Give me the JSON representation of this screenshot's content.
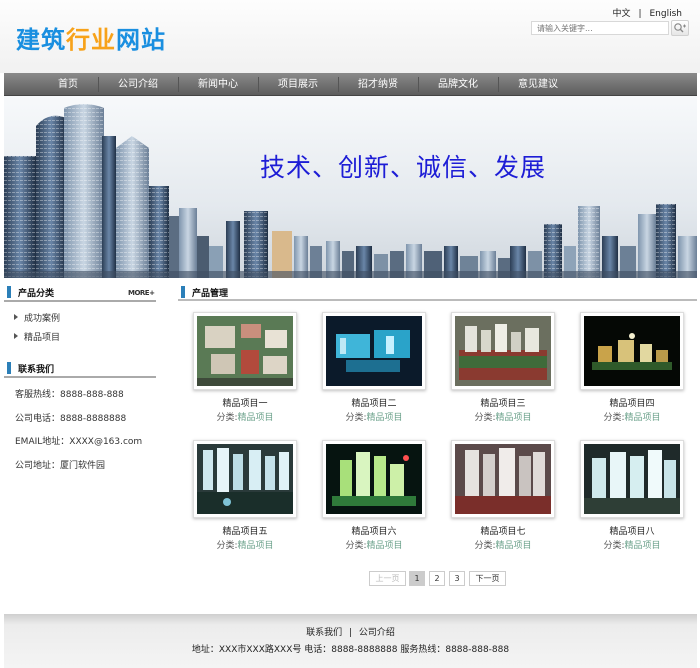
{
  "header": {
    "logo_part1": "建筑",
    "logo_part2": "行业",
    "logo_part3": "网站",
    "lang_cn": "中文",
    "lang_sep": "|",
    "lang_en": "English",
    "search_placeholder": "请输入关键字..."
  },
  "nav": {
    "items": [
      "首页",
      "公司介绍",
      "新闻中心",
      "项目展示",
      "招才纳贤",
      "品牌文化",
      "意见建议"
    ]
  },
  "banner": {
    "slogan": "技术、创新、诚信、发展"
  },
  "sidebar": {
    "category_title": "产品分类",
    "more_label": "MORE+",
    "categories": [
      "成功案例",
      "精品项目"
    ],
    "contact_title": "联系我们",
    "contacts": [
      "客服热线：8888-888-888",
      "公司电话：8888-8888888",
      "EMAIL地址：XXXX@163.com",
      "公司地址：厦门软件园"
    ]
  },
  "main": {
    "title": "产品管理",
    "category_prefix": "分类:",
    "products": [
      {
        "name": "精品项目一",
        "category": "精品项目"
      },
      {
        "name": "精品项目二",
        "category": "精品项目"
      },
      {
        "name": "精品项目三",
        "category": "精品项目"
      },
      {
        "name": "精品项目四",
        "category": "精品项目"
      },
      {
        "name": "精品项目五",
        "category": "精品项目"
      },
      {
        "name": "精品项目六",
        "category": "精品项目"
      },
      {
        "name": "精品项目七",
        "category": "精品项目"
      },
      {
        "name": "精品项目八",
        "category": "精品项目"
      }
    ]
  },
  "pagination": {
    "prev": "上一页",
    "pages": [
      "1",
      "2",
      "3"
    ],
    "current": "1",
    "next": "下一页"
  },
  "footer": {
    "link1": "联系我们",
    "sep": "|",
    "link2": "公司介绍",
    "address": "地址：XXX市XXX路XXX号 电话：8888-8888888 服务热线：8888-888-888"
  },
  "colors": {
    "accent_blue": "#2b7fb8",
    "slogan": "#1d1dd6",
    "category_value": "#6aa08a"
  }
}
